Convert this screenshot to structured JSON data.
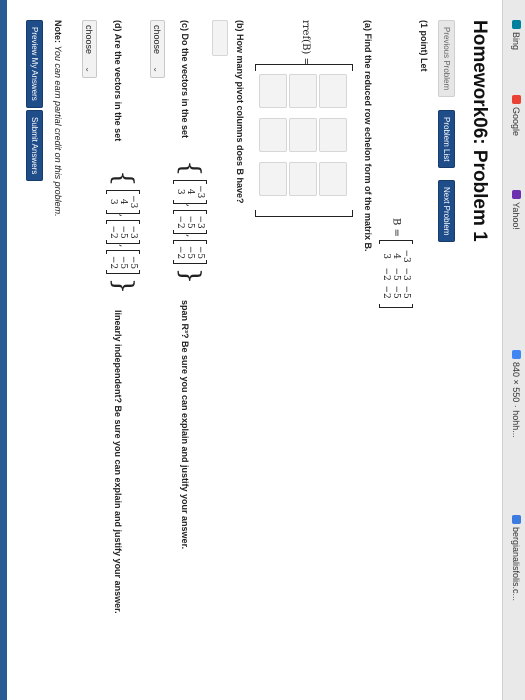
{
  "bookmarks": [
    {
      "label": "bergianalisfolis.c...",
      "icon": "bookmark-icon"
    },
    {
      "label": "840 × 550 · hohh...",
      "icon": "google-icon"
    },
    {
      "label": "Yahoo!",
      "icon": "yahoo-icon"
    },
    {
      "label": "Google",
      "icon": "google-icon"
    },
    {
      "label": "Bing",
      "icon": "bing-icon"
    }
  ],
  "header": {
    "title": "Homework06: Problem 1"
  },
  "nav": {
    "previous": "Previous Problem",
    "list": "Problem List",
    "next": "Next Problem"
  },
  "problem": {
    "points": "(1 point) Let",
    "matrix_label": "B =",
    "matrix": [
      "−3",
      "−3",
      "−5",
      "4",
      "−5",
      "−5",
      "3",
      "−2",
      "−2"
    ],
    "part_a": "(a) Find the reduced row echelon form of the matrix B.",
    "rref_label": "rref(B) =",
    "part_b": "(b) How many pivot columns does B have?",
    "part_c_prefix": "(c) Do the vectors in the set",
    "part_c_suffix": "span R³? Be sure you can explain and justify your answer.",
    "part_d_prefix": "(d) Are the vectors in the set",
    "part_d_suffix": "linearly independent? Be sure you can explain and justify your answer.",
    "vectors": [
      [
        "−3",
        "4",
        "3"
      ],
      [
        "−3",
        "−5",
        "−2"
      ],
      [
        "−5",
        "−5",
        "−2"
      ]
    ],
    "choose_c": "choose",
    "choose_d": "choose",
    "note_label": "Note:",
    "note_text": "You can earn partial credit on this problem."
  },
  "actions": {
    "preview": "Preview My Answers",
    "submit": "Submit Answers"
  },
  "colors": {
    "accent": "#1f4d8a"
  }
}
